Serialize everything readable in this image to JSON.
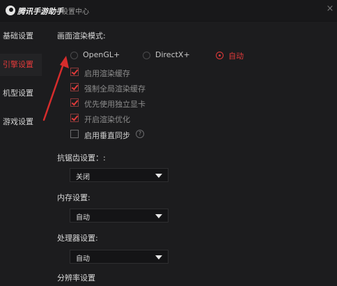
{
  "window": {
    "brand": "腾讯手游助手",
    "separator": "-",
    "page": "设置中心"
  },
  "sidebar": {
    "items": [
      {
        "label": "基础设置",
        "active": false
      },
      {
        "label": "引擎设置",
        "active": true
      },
      {
        "label": "机型设置",
        "active": false
      },
      {
        "label": "游戏设置",
        "active": false
      }
    ]
  },
  "render": {
    "label": "画面渲染模式:",
    "options": [
      "OpenGL+",
      "DirectX+",
      "自动"
    ],
    "selected": "自动"
  },
  "checkboxes": [
    {
      "label": "启用渲染缓存",
      "checked": true
    },
    {
      "label": "强制全局渲染缓存",
      "checked": true
    },
    {
      "label": "优先使用独立显卡",
      "checked": true
    },
    {
      "label": "开启渲染优化",
      "checked": true
    },
    {
      "label": "启用垂直同步",
      "checked": false
    }
  ],
  "help_glyph": "?",
  "antialias": {
    "label": "抗锯齿设置：:",
    "value": "关闭"
  },
  "memory": {
    "label": "内存设置:",
    "value": "自动"
  },
  "cpu": {
    "label": "处理器设置:",
    "value": "自动"
  },
  "resolution": {
    "label": "分辨率设置"
  },
  "close_glyph": "×",
  "colors": {
    "accent": "#e23a3a",
    "background": "#1c1c1e"
  }
}
